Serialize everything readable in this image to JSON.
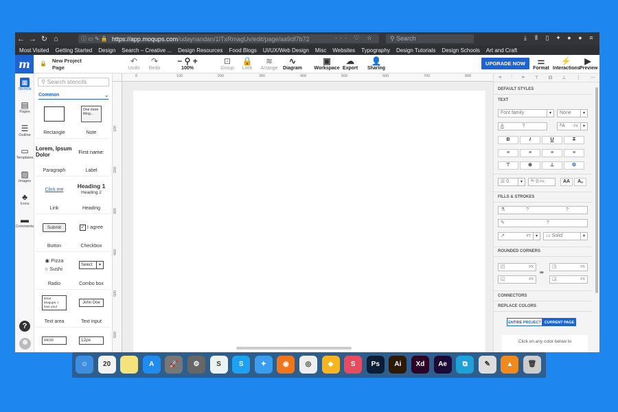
{
  "browser": {
    "url_host": "https://app.moqups.com",
    "url_path": "/udaynandan/1ITxRmagUv/edit/page/aa9df7b72",
    "search_placeholder": "Search",
    "bookmarks": [
      "Most Visited",
      "Getting Started",
      "Design",
      "Search – Creative ...",
      "Design Resources",
      "Food Blogs",
      "UI/UX/Web Design",
      "Misc",
      "Websites",
      "Typography",
      "Design Tutorials",
      "Design Schools",
      "Art and Craft"
    ]
  },
  "app": {
    "logo": "m",
    "project_title": "New Project",
    "page_title": "Page",
    "toolbar": [
      {
        "icon": "↶",
        "label": "Undo"
      },
      {
        "icon": "↷",
        "label": "Redo"
      },
      {
        "icon": "− ⚲ +",
        "label": "100%"
      },
      {
        "icon": "⊡",
        "label": "Group"
      },
      {
        "icon": "🔒",
        "label": "Lock"
      },
      {
        "icon": "≋",
        "label": "Arrange"
      },
      {
        "icon": "∿",
        "label": "Diagram"
      },
      {
        "icon": "▣",
        "label": "Workspace"
      },
      {
        "icon": "☁",
        "label": "Export"
      },
      {
        "icon": "👤",
        "label": "Sharing"
      }
    ],
    "upgrade_label": "UPGRADE NOW",
    "right_tools": [
      {
        "icon": "⚌",
        "label": "Format"
      },
      {
        "icon": "⚡",
        "label": "Interactions"
      },
      {
        "icon": "▶",
        "label": "Preview"
      }
    ]
  },
  "sidebar": [
    {
      "icon": "▦",
      "label": "Stencils"
    },
    {
      "icon": "▤",
      "label": "Pages"
    },
    {
      "icon": "☰",
      "label": "Outline"
    },
    {
      "icon": "▭",
      "label": "Templates"
    },
    {
      "icon": "▨",
      "label": "Images"
    },
    {
      "icon": "♣",
      "label": "Icons"
    },
    {
      "icon": "▬",
      "label": "Comments"
    }
  ],
  "stencils": {
    "search_placeholder": "Search stencils",
    "section": "Common",
    "items": [
      {
        "label": "Rectangle",
        "preview": ""
      },
      {
        "label": "Note",
        "preview": "One more thing..."
      },
      {
        "label": "Paragraph",
        "preview": "Lorem, Ipsum Dolor"
      },
      {
        "label": "Label",
        "preview": "First name:"
      },
      {
        "label": "Link",
        "preview": "Click me"
      },
      {
        "label": "Heading",
        "preview": "Heading 1",
        "preview2": "Heading 2"
      },
      {
        "label": "Button",
        "preview": "Submit"
      },
      {
        "label": "Checkbox",
        "preview": "I agree"
      },
      {
        "label": "Radio",
        "preview": "Pizza",
        "preview2": "Sushi"
      },
      {
        "label": "Combo box",
        "preview": "Select"
      },
      {
        "label": "Text area",
        "preview": "Dear Moqups, I love you!"
      },
      {
        "label": "Text input",
        "preview": "John Doe"
      },
      {
        "label": "",
        "preview": "04/30"
      },
      {
        "label": "",
        "preview": "12px"
      }
    ]
  },
  "ruler": {
    "h": [
      "0",
      "100",
      "200",
      "300",
      "400",
      "500",
      "600",
      "700",
      "800"
    ],
    "v": [
      "100",
      "200",
      "300",
      "400",
      "500",
      "600"
    ]
  },
  "panel": {
    "default_styles": "DEFAULT STYLES",
    "plus": "[+]",
    "text": "TEXT",
    "font_family": "Font family",
    "font_weight": "None",
    "q": "?",
    "px": "PX",
    "indent": "0",
    "spacing": "0",
    "aa1": "AA",
    "aa2": "Aₐ",
    "fills": "FILLS & STROKES",
    "pt": "PT",
    "solid": "Solid",
    "rounded": "ROUNDED CORNERS",
    "connectors": "CONNECTORS",
    "replace": "REPLACE COLORS",
    "entire": "ENTIRE PROJECT",
    "current": "CURRENT PAGE",
    "hint": "Click on any color below to"
  },
  "dock": [
    {
      "label": "",
      "bg": "#3d8ee0",
      "glyph": "☺"
    },
    {
      "label": "20",
      "bg": "#f3f3f3",
      "glyph": "20"
    },
    {
      "label": "",
      "bg": "#f5e27a",
      "glyph": ""
    },
    {
      "label": "",
      "bg": "#1f8cf0",
      "glyph": "A"
    },
    {
      "label": "",
      "bg": "#777",
      "glyph": "🚀"
    },
    {
      "label": "",
      "bg": "#666",
      "glyph": "⚙"
    },
    {
      "label": "",
      "bg": "#ecf3f3",
      "glyph": "S"
    },
    {
      "label": "",
      "bg": "#1da1f2",
      "glyph": "S"
    },
    {
      "label": "",
      "bg": "#3a9df0",
      "glyph": "✦"
    },
    {
      "label": "",
      "bg": "#f0761e",
      "glyph": "◉"
    },
    {
      "label": "",
      "bg": "#eee",
      "glyph": "◎"
    },
    {
      "label": "",
      "bg": "#f7b520",
      "glyph": "◆"
    },
    {
      "label": "",
      "bg": "#e64b5f",
      "glyph": "S"
    },
    {
      "label": "Ps",
      "bg": "#0b1e35",
      "glyph": "Ps"
    },
    {
      "label": "Ai",
      "bg": "#2d1a05",
      "glyph": "Ai"
    },
    {
      "label": "Xd",
      "bg": "#2e0227",
      "glyph": "Xd"
    },
    {
      "label": "Ae",
      "bg": "#1b0a36",
      "glyph": "Ae"
    },
    {
      "label": "",
      "bg": "#1ea0d8",
      "glyph": "⧉"
    },
    {
      "label": "",
      "bg": "#ddd",
      "glyph": "✎"
    },
    {
      "label": "",
      "bg": "#f08a1e",
      "glyph": "▲"
    },
    {
      "label": "",
      "bg": "#ccc",
      "glyph": "🗑"
    }
  ]
}
